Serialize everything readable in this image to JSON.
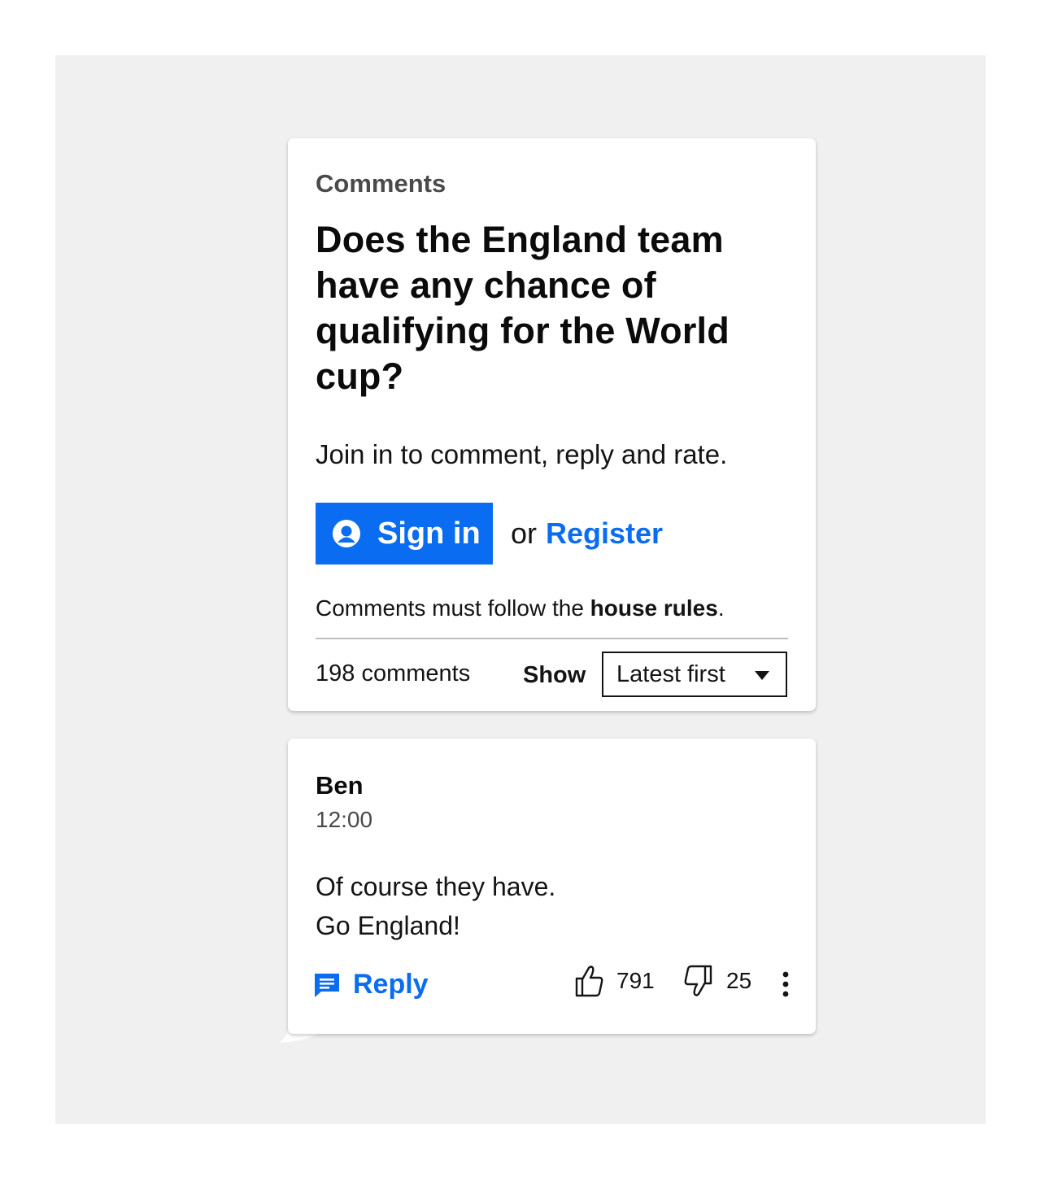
{
  "header": {
    "eyebrow": "Comments",
    "question": "Does the England team have any chance of qualifying for the World cup?",
    "join_text": "Join in to comment, reply and rate.",
    "sign_in_label": "Sign in",
    "or_text": "or",
    "register_label": "Register",
    "rules_prefix": "Comments must follow the",
    "rules_link": "house rules",
    "rules_suffix": ".",
    "comment_count": "198 comments",
    "show_label": "Show",
    "sort_selected": "Latest first"
  },
  "comment": {
    "author": "Ben",
    "time": "12:00",
    "lines": [
      "Of course they have.",
      "Go England!"
    ],
    "reply_label": "Reply",
    "likes": "791",
    "dislikes": "25"
  },
  "icons": {
    "sign_in": "user-icon",
    "reply": "comment-icon",
    "like": "thumbs-up-icon",
    "dislike": "thumbs-down-icon",
    "more": "more-vertical-icon",
    "sort": "caret-down-icon"
  },
  "colors": {
    "accent": "#0a6cf0",
    "background": "#f0f0f0",
    "text": "#141414"
  }
}
